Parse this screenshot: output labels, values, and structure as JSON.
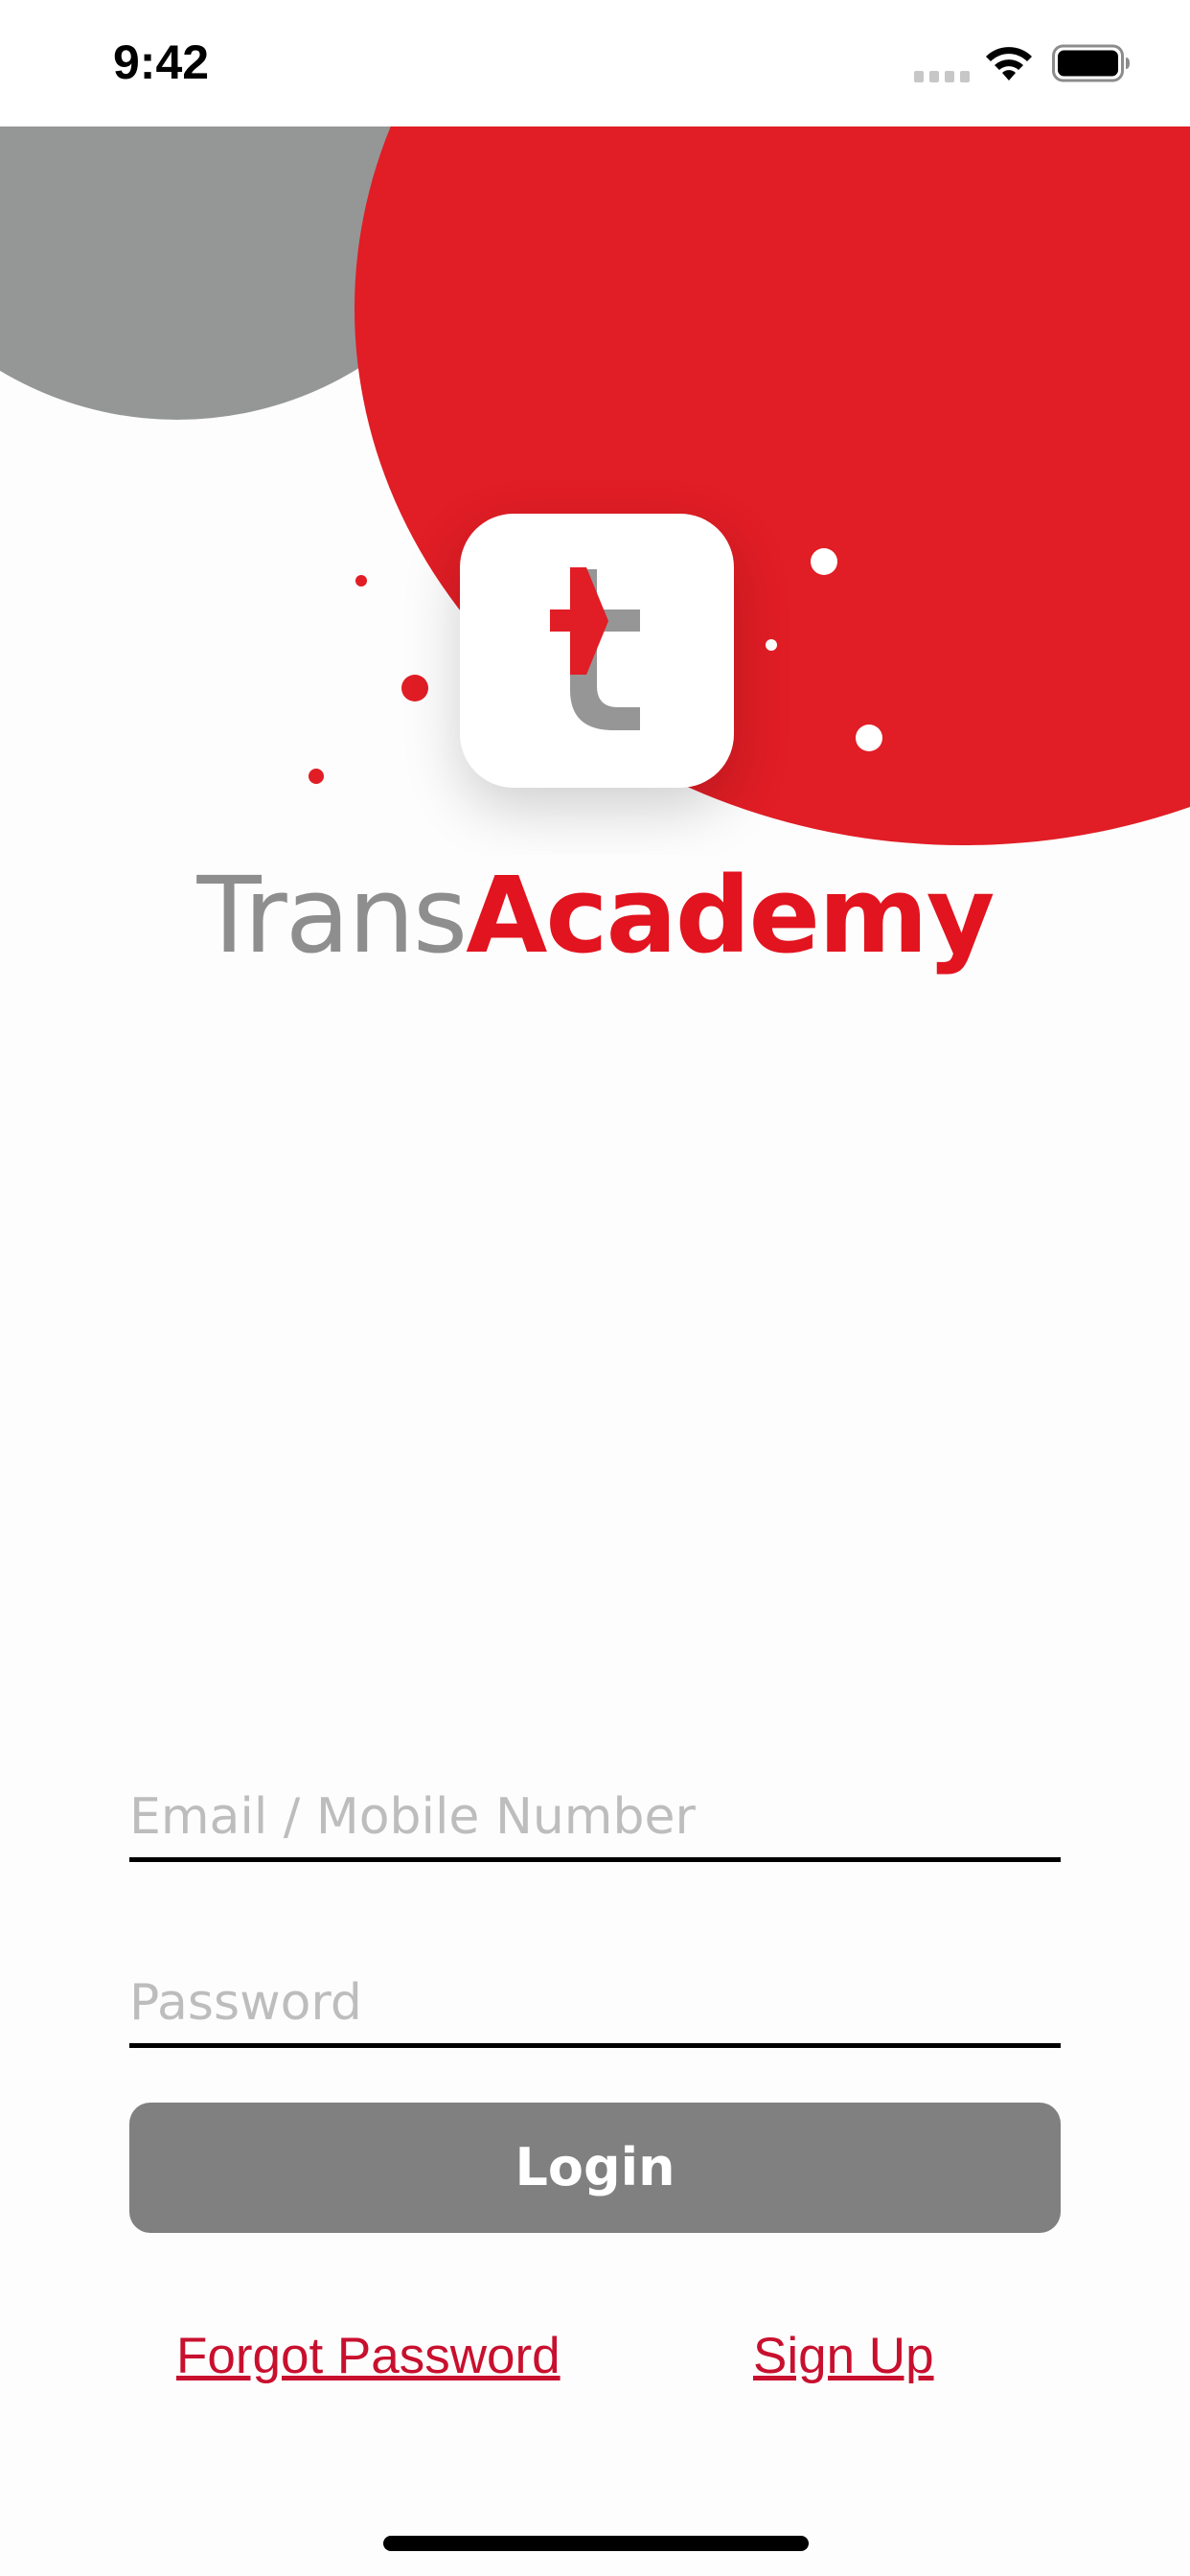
{
  "status_bar": {
    "time": "9:42"
  },
  "brand": {
    "name_part_1": "Trans",
    "name_part_2": "Academy",
    "logo_letter": "t"
  },
  "login_form": {
    "email_placeholder": "Email / Mobile Number",
    "email_value": "",
    "password_placeholder": "Password",
    "password_value": "",
    "login_label": "Login",
    "forgot_password_label": "Forgot Password",
    "sign_up_label": "Sign Up"
  },
  "icons": {
    "signal": "signal-icon",
    "wifi": "wifi-icon",
    "battery": "battery-icon",
    "app_logo": "app-logo-icon"
  },
  "colors": {
    "brand_red": "#E11D25",
    "brand_gray": "#959696",
    "login_button": "#808080",
    "link": "#C8102E",
    "placeholder": "#BDBDBD"
  }
}
